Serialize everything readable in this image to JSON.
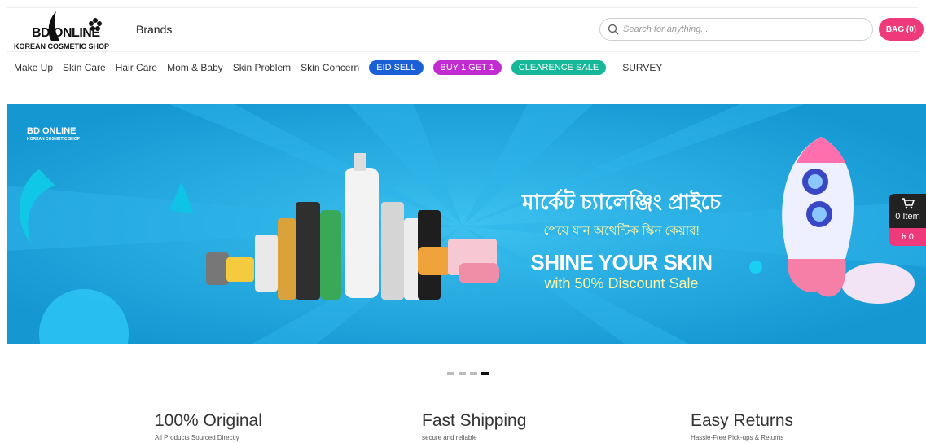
{
  "header": {
    "logo_brand": "BD ONLINE",
    "logo_tagline": "KOREAN COSMETIC SHOP",
    "brands_link": "Brands",
    "search_placeholder": "Search for anything...",
    "bag_label": "BAG (0)"
  },
  "nav": {
    "items": [
      "Make Up",
      "Skin Care",
      "Hair Care",
      "Mom & Baby",
      "Skin Problem",
      "Skin Concern"
    ],
    "pills": [
      {
        "label": "EID SELL",
        "color": "#1a5fd6"
      },
      {
        "label": "BUY 1 GET 1",
        "color": "#c22bd1"
      },
      {
        "label": "CLEARENCE SALE",
        "color": "#17b79a"
      }
    ],
    "survey": "SURVEY"
  },
  "banner": {
    "logo_brand": "BD ONLINE",
    "logo_tagline": "KOREAN COSMETIC SHOP",
    "line1": "মার্কেট চ্যালেঞ্জিং প্রাইচে",
    "line2": "পেয়ে যান অথেন্টিক স্কিন কেয়ার!",
    "line3": "SHINE YOUR SKIN",
    "line4": "with 50% Discount Sale",
    "background_color": "#1aa3dc"
  },
  "cart_widget": {
    "items_label": "0 Item",
    "total": "৳ 0"
  },
  "carousel": {
    "dot_count": 4,
    "active_index": 3
  },
  "features": [
    {
      "title": "100% Original",
      "subtitle": "All Products Sourced Directly"
    },
    {
      "title": "Fast Shipping",
      "subtitle": "secure and reliable"
    },
    {
      "title": "Easy Returns",
      "subtitle": "Hassle-Free Pick-ups & Returns"
    }
  ]
}
